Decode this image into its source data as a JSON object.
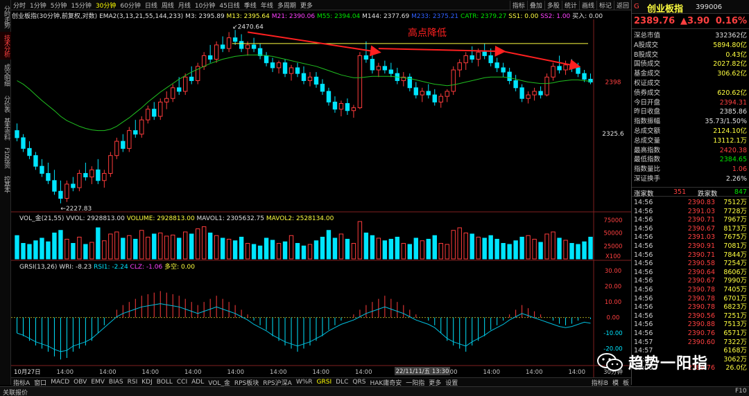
{
  "vertical_tabs": [
    "分时走势",
    "技术分析",
    "成交明细",
    "分价表",
    "基本资料",
    "F10投资",
    "控基本"
  ],
  "toolbar": {
    "periods": [
      "分时",
      "1分钟",
      "5分钟",
      "15分钟",
      "30分钟",
      "60分钟",
      "日线",
      "周线",
      "月线",
      "10分钟",
      "45日线",
      "季线",
      "年线",
      "多周期",
      "更多"
    ],
    "active_period": "30分钟",
    "right_items": [
      "指标",
      "叠加",
      "多股",
      "统计",
      "画线",
      "标记",
      "返回"
    ]
  },
  "info_bar": {
    "name": "创业板指(30分钟,前复权,对数)",
    "ema": "EMA2(3,13,21,55,144,233)",
    "m3": "M3: 2395.89",
    "m13": "M13: 2395.64",
    "m21": "M21: 2390.06",
    "m55": "M55: 2394.04",
    "m144": "M144: 2377.69",
    "m233": "M233: 2375.21",
    "catr": "CATR: 2379.27",
    "ss1": "SS1: 0.00",
    "ss2": "SS2: 1.00",
    "buy": "买入: 0.00"
  },
  "annotations": {
    "title": "高点降低",
    "high": "2470.64",
    "low": "2227.83",
    "right_price_1": "2398",
    "right_price_2": "2325.6"
  },
  "vol_panel": {
    "label": "VOL_金(21,55)",
    "vvol": "VVOL: 2928813.00",
    "volume": "VOLUME: 2928813.00",
    "mavol1": "MAVOL1: 2305632.75",
    "mavol2": "MAVOL2: 2528134.00",
    "axis": [
      "75000",
      "50000",
      "25000"
    ],
    "unit": "X100"
  },
  "grsi_panel": {
    "label": "GRSI(13,26)",
    "wri": "WRI: -8.23",
    "rsi1": "RSI1: -2.24",
    "clz": "CLZ: -1.06",
    "duokong": "多空: 0.00",
    "axis": [
      "30.00",
      "20.00",
      "10.00",
      "0.00",
      "-10.00",
      "-20.00"
    ]
  },
  "time_axis": {
    "labels": [
      "10月27日",
      "14:00",
      "14:00",
      "14:00",
      "14:00",
      "14:00",
      "14:00",
      "14:00",
      "14:00",
      "14:00",
      "14:00",
      "14:00",
      "14:00",
      "14:00"
    ],
    "cursor": "22/11/11/五 13:30",
    "end_label": "30分钟"
  },
  "bottom_tabs": [
    "指标A",
    "窗口",
    "MACD",
    "OBV",
    "EMV",
    "BIAS",
    "RSI",
    "KDJ",
    "BOLL",
    "CCI",
    "ADL",
    "VOL_金",
    "RPS板块",
    "RPS沪深A",
    "W%R",
    "GRSI",
    "DLC",
    "QRS",
    "HAK庸奇安",
    "一阳指",
    "更多",
    "设置"
  ],
  "bottom_active": "GRSI",
  "bottom_right": [
    "指标B",
    "模",
    "板"
  ],
  "status": {
    "left": "关联报价",
    "right": "F10"
  },
  "quote": {
    "g_label": "G",
    "name": "创业板指",
    "code": "399006",
    "price": "2389.76",
    "change": "▲3.90",
    "pct": "0.16%",
    "rows": [
      {
        "label": "深总市值",
        "value": "332362亿",
        "color": "white"
      },
      {
        "label": "A股成交",
        "value": "5894.80亿",
        "color": "yellow"
      },
      {
        "label": "B股成交",
        "value": "0.43亿",
        "color": "yellow"
      },
      {
        "label": "国债成交",
        "value": "2027.82亿",
        "color": "yellow"
      },
      {
        "label": "基金成交",
        "value": "306.62亿",
        "color": "yellow"
      },
      {
        "label": "权证成交",
        "value": "",
        "color": "yellow"
      },
      {
        "label": "债券成交",
        "value": "620.62亿",
        "color": "yellow"
      },
      {
        "label": "今日开盘",
        "value": "2394.31",
        "color": "red"
      },
      {
        "label": "昨日收盘",
        "value": "2385.86",
        "color": "white"
      },
      {
        "label": "指数振幅",
        "value": "35.73/1.50%",
        "color": "white"
      },
      {
        "label": "总成交额",
        "value": "2124.10亿",
        "color": "yellow"
      },
      {
        "label": "总成交量",
        "value": "13112.1万",
        "color": "yellow"
      },
      {
        "label": "最高指数",
        "value": "2420.38",
        "color": "red"
      },
      {
        "label": "最低指数",
        "value": "2384.65",
        "color": "green"
      },
      {
        "label": "指数量比",
        "value": "1.06",
        "color": "red"
      },
      {
        "label": "深证换手",
        "value": "2.26%",
        "color": "white"
      }
    ],
    "rise_label": "涨家数",
    "rise": "351",
    "fall_label": "跌家数",
    "fall": "847"
  },
  "ticks": [
    {
      "t": "14:56",
      "p": "2390.83",
      "v": "7512万"
    },
    {
      "t": "14:56",
      "p": "2391.03",
      "v": "7728万"
    },
    {
      "t": "14:56",
      "p": "2390.71",
      "v": "7967万"
    },
    {
      "t": "14:56",
      "p": "2390.67",
      "v": "8173万"
    },
    {
      "t": "14:56",
      "p": "2391.03",
      "v": "7675万"
    },
    {
      "t": "14:56",
      "p": "2390.91",
      "v": "7081万"
    },
    {
      "t": "14:56",
      "p": "2390.71",
      "v": "7844万"
    },
    {
      "t": "14:56",
      "p": "2390.58",
      "v": "7254万"
    },
    {
      "t": "14:56",
      "p": "2390.64",
      "v": "8606万"
    },
    {
      "t": "14:56",
      "p": "2390.67",
      "v": "7990万"
    },
    {
      "t": "14:56",
      "p": "2390.78",
      "v": "7405万"
    },
    {
      "t": "14:56",
      "p": "2390.78",
      "v": "6701万"
    },
    {
      "t": "14:56",
      "p": "2390.78",
      "v": "6823万"
    },
    {
      "t": "14:56",
      "p": "2390.56",
      "v": "7251万"
    },
    {
      "t": "14:56",
      "p": "2390.88",
      "v": "7513万"
    },
    {
      "t": "14:56",
      "p": "2390.76",
      "v": "6571万"
    },
    {
      "t": "14:57",
      "p": "2390.60",
      "v": "7322万"
    },
    {
      "t": "14:57",
      "p": "",
      "v": "6168万"
    },
    {
      "t": "14:57",
      "p": "",
      "v": "3062万"
    },
    {
      "t": "15:00",
      "p": "2389.76",
      "v": "26.0亿"
    }
  ],
  "watermark": "趋势一阳指",
  "chart_data": {
    "type": "candlestick",
    "title": "创业板指(30分钟,前复权,对数)",
    "ohlc": [
      [
        2330,
        2340,
        2315,
        2320
      ],
      [
        2320,
        2325,
        2300,
        2305
      ],
      [
        2305,
        2315,
        2290,
        2295
      ],
      [
        2295,
        2300,
        2275,
        2280
      ],
      [
        2280,
        2290,
        2265,
        2270
      ],
      [
        2270,
        2285,
        2255,
        2260
      ],
      [
        2260,
        2275,
        2240,
        2245
      ],
      [
        2245,
        2260,
        2228,
        2235
      ],
      [
        2235,
        2260,
        2230,
        2255
      ],
      [
        2255,
        2265,
        2245,
        2250
      ],
      [
        2250,
        2275,
        2245,
        2270
      ],
      [
        2270,
        2285,
        2260,
        2265
      ],
      [
        2265,
        2280,
        2255,
        2275
      ],
      [
        2275,
        2290,
        2255,
        2260
      ],
      [
        2260,
        2275,
        2250,
        2270
      ],
      [
        2270,
        2300,
        2265,
        2295
      ],
      [
        2295,
        2320,
        2290,
        2315
      ],
      [
        2315,
        2325,
        2300,
        2305
      ],
      [
        2305,
        2335,
        2300,
        2330
      ],
      [
        2330,
        2345,
        2320,
        2325
      ],
      [
        2325,
        2350,
        2320,
        2345
      ],
      [
        2345,
        2365,
        2340,
        2360
      ],
      [
        2360,
        2370,
        2345,
        2350
      ],
      [
        2350,
        2375,
        2345,
        2370
      ],
      [
        2370,
        2385,
        2360,
        2375
      ],
      [
        2375,
        2395,
        2370,
        2390
      ],
      [
        2390,
        2405,
        2380,
        2385
      ],
      [
        2385,
        2410,
        2380,
        2405
      ],
      [
        2405,
        2420,
        2395,
        2400
      ],
      [
        2400,
        2425,
        2395,
        2420
      ],
      [
        2420,
        2440,
        2415,
        2435
      ],
      [
        2435,
        2450,
        2425,
        2430
      ],
      [
        2430,
        2455,
        2425,
        2450
      ],
      [
        2450,
        2462,
        2440,
        2445
      ],
      [
        2445,
        2468,
        2440,
        2460
      ],
      [
        2460,
        2471,
        2450,
        2455
      ],
      [
        2455,
        2465,
        2440,
        2445
      ],
      [
        2445,
        2455,
        2435,
        2450
      ],
      [
        2450,
        2460,
        2440,
        2445
      ],
      [
        2445,
        2452,
        2430,
        2435
      ],
      [
        2435,
        2440,
        2420,
        2425
      ],
      [
        2425,
        2432,
        2412,
        2418
      ],
      [
        2418,
        2428,
        2410,
        2425
      ],
      [
        2425,
        2430,
        2405,
        2410
      ],
      [
        2410,
        2422,
        2400,
        2418
      ],
      [
        2418,
        2425,
        2405,
        2410
      ],
      [
        2410,
        2420,
        2395,
        2400
      ],
      [
        2400,
        2412,
        2392,
        2405
      ],
      [
        2405,
        2412,
        2390,
        2395
      ],
      [
        2395,
        2402,
        2380,
        2385
      ],
      [
        2385,
        2390,
        2365,
        2370
      ],
      [
        2370,
        2378,
        2355,
        2360
      ],
      [
        2360,
        2372,
        2350,
        2368
      ],
      [
        2368,
        2375,
        2352,
        2358
      ],
      [
        2358,
        2366,
        2348,
        2362
      ],
      [
        2362,
        2440,
        2360,
        2435
      ],
      [
        2435,
        2455,
        2425,
        2430
      ],
      [
        2430,
        2440,
        2410,
        2415
      ],
      [
        2415,
        2425,
        2405,
        2420
      ],
      [
        2420,
        2428,
        2410,
        2415
      ],
      [
        2415,
        2425,
        2405,
        2410
      ],
      [
        2410,
        2418,
        2395,
        2400
      ],
      [
        2400,
        2412,
        2392,
        2405
      ],
      [
        2405,
        2410,
        2385,
        2390
      ],
      [
        2390,
        2398,
        2375,
        2380
      ],
      [
        2380,
        2390,
        2370,
        2385
      ],
      [
        2385,
        2395,
        2375,
        2380
      ],
      [
        2380,
        2388,
        2365,
        2370
      ],
      [
        2370,
        2382,
        2362,
        2378
      ],
      [
        2378,
        2388,
        2370,
        2385
      ],
      [
        2385,
        2420,
        2380,
        2415
      ],
      [
        2415,
        2430,
        2405,
        2425
      ],
      [
        2425,
        2440,
        2415,
        2435
      ],
      [
        2435,
        2448,
        2425,
        2430
      ],
      [
        2430,
        2445,
        2420,
        2440
      ],
      [
        2440,
        2452,
        2430,
        2435
      ],
      [
        2435,
        2445,
        2420,
        2425
      ],
      [
        2425,
        2432,
        2412,
        2418
      ],
      [
        2418,
        2425,
        2405,
        2412
      ],
      [
        2412,
        2418,
        2395,
        2400
      ],
      [
        2400,
        2408,
        2385,
        2390
      ],
      [
        2390,
        2395,
        2370,
        2375
      ],
      [
        2375,
        2385,
        2368,
        2380
      ],
      [
        2380,
        2390,
        2372,
        2385
      ],
      [
        2385,
        2392,
        2375,
        2380
      ],
      [
        2380,
        2410,
        2378,
        2405
      ],
      [
        2405,
        2425,
        2400,
        2420
      ],
      [
        2420,
        2435,
        2410,
        2415
      ],
      [
        2415,
        2428,
        2408,
        2422
      ],
      [
        2422,
        2430,
        2412,
        2418
      ],
      [
        2418,
        2425,
        2405,
        2410
      ],
      [
        2410,
        2415,
        2398,
        2402
      ],
      [
        2402,
        2410,
        2395,
        2398
      ]
    ],
    "ma_line": [
      2400,
      2395,
      2388,
      2380,
      2372,
      2365,
      2358,
      2350,
      2344,
      2340,
      2336,
      2333,
      2331,
      2330,
      2330,
      2332,
      2336,
      2342,
      2348,
      2355,
      2362,
      2370,
      2377,
      2384,
      2390,
      2396,
      2402,
      2407,
      2412,
      2416,
      2420,
      2424,
      2427,
      2430,
      2432,
      2434,
      2435,
      2436,
      2436,
      2436,
      2435,
      2434,
      2432,
      2430,
      2428,
      2426,
      2424,
      2422,
      2420,
      2417,
      2414,
      2411,
      2408,
      2406,
      2404,
      2404,
      2405,
      2406,
      2406,
      2406,
      2406,
      2405,
      2404,
      2403,
      2401,
      2399,
      2397,
      2395,
      2394,
      2393,
      2394,
      2396,
      2398,
      2400,
      2402,
      2404,
      2405,
      2405,
      2405,
      2404,
      2402,
      2400,
      2398,
      2397,
      2396,
      2396,
      2397,
      2399,
      2400,
      2401,
      2401,
      2400,
      2399
    ],
    "price_range": [
      2220,
      2480
    ],
    "yellow_line": 2452,
    "volume": [
      45,
      30,
      28,
      35,
      40,
      33,
      50,
      55,
      38,
      30,
      42,
      28,
      32,
      60,
      35,
      48,
      52,
      40,
      45,
      38,
      55,
      42,
      48,
      50,
      44,
      46,
      40,
      52,
      48,
      58,
      62,
      50,
      45,
      40,
      38,
      35,
      42,
      30,
      28,
      25,
      40,
      36,
      30,
      33,
      45,
      30,
      25,
      28,
      35,
      42,
      55,
      40,
      48,
      38,
      30,
      72,
      50,
      45,
      40,
      35,
      38,
      42,
      30,
      28,
      40,
      35,
      38,
      45,
      30,
      28,
      55,
      60,
      50,
      48,
      42,
      40,
      45,
      38,
      30,
      28,
      35,
      42,
      45,
      38,
      32,
      48,
      52,
      40,
      36,
      30,
      28,
      33,
      42
    ],
    "grsi": [
      -10,
      -12,
      -15,
      -18,
      -20,
      -22,
      -25,
      -27,
      -26,
      -22,
      -20,
      -18,
      -15,
      -10,
      -5,
      0,
      5,
      8,
      10,
      12,
      14,
      15,
      16,
      17,
      16,
      15,
      14,
      12,
      10,
      8,
      10,
      12,
      14,
      12,
      10,
      8,
      5,
      2,
      -2,
      -5,
      -8,
      -12,
      -15,
      -18,
      -20,
      -22,
      -20,
      -18,
      -15,
      -12,
      -8,
      -5,
      -2,
      0,
      2,
      5,
      8,
      10,
      12,
      14,
      12,
      10,
      8,
      5,
      2,
      0,
      -2,
      -5,
      -10,
      -15,
      -18,
      -20,
      -22,
      -18,
      -15,
      -12,
      -8,
      -5,
      -2,
      2,
      5,
      8,
      6,
      4,
      2,
      0,
      -2,
      -4,
      -5,
      -4,
      -2,
      0,
      -1
    ],
    "grsi_range": [
      -30,
      35
    ]
  }
}
